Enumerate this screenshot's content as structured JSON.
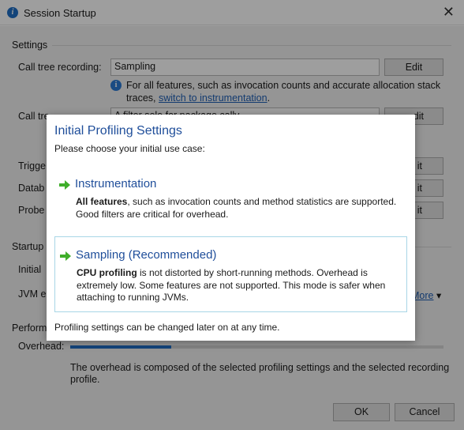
{
  "window": {
    "title": "Session Startup",
    "close_glyph": "✕"
  },
  "settings": {
    "section_label": "Settings",
    "call_tree_recording": {
      "label": "Call tree recording:",
      "value": "Sampling",
      "edit": "Edit"
    },
    "info_text": "For all features, such as invocation counts and accurate allocation stack",
    "info_text2": "traces,",
    "info_link": "switch to instrumentation",
    "info_text_end": ".",
    "call_tree_filters": {
      "label_partial": "Call tre",
      "value_partial": "A filter sele   for   package   cally",
      "edit_partial": "dit"
    },
    "triggers": {
      "label_partial": "Trigge",
      "edit_partial": "it"
    },
    "databases": {
      "label_partial": "Datab",
      "edit_partial": "it"
    },
    "probes": {
      "label_partial": "Probe",
      "edit_partial": "it"
    }
  },
  "startup": {
    "section_label": "Startup",
    "initial_partial": "Initial",
    "jvm_partial": "JVM e",
    "more_link": "More",
    "more_caret": "▾"
  },
  "performance": {
    "section_label_partial": "Perform",
    "overhead_label": "Overhead:",
    "overhead_level": 0.27,
    "note_line1": "The overhead is composed of the selected profiling settings and the selected recording",
    "note_line2": "profile."
  },
  "footer": {
    "ok": "OK",
    "cancel": "Cancel"
  },
  "modal": {
    "title": "Initial Profiling Settings",
    "subtitle": "Please choose your initial use case:",
    "options": [
      {
        "title": "Instrumentation",
        "desc_bold": "All features",
        "desc_rest": ", such as invocation counts and method statistics are supported. Good filters are critical for overhead."
      },
      {
        "title": "Sampling (Recommended)",
        "desc_bold": "CPU profiling",
        "desc_rest": " is not distorted by short-running methods. Overhead is extremely low. Some features are not supported. This mode is safer when attaching to running JVMs."
      }
    ],
    "footer_text": "Profiling settings can be changed later on at any time."
  },
  "colors": {
    "accent": "#1f4e9a",
    "arrow_green": "#3fae2a",
    "selected_border": "#a8d6e6",
    "progress": "#1f6fc5"
  }
}
